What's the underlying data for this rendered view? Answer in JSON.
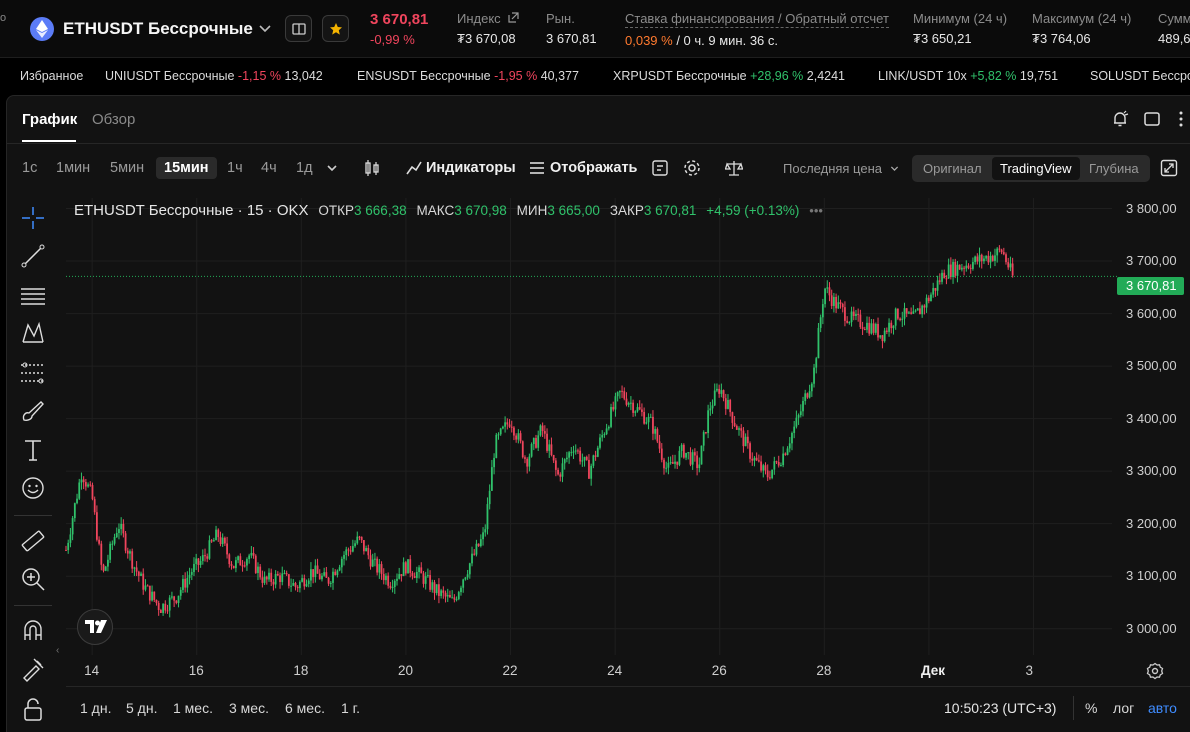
{
  "header": {
    "edge_text": "о",
    "pair": "ETHUSDT Бессрочные",
    "last_price": "3 670,81",
    "last_change": "-0,99 %",
    "stats": [
      {
        "label": "Индекс",
        "value": "₮3 670,08"
      },
      {
        "label": "Рын.",
        "value": "3 670,81"
      },
      {
        "label": "Ставка финансирования / Обратный отсчет",
        "rate": "0,039 %",
        "countdown": " / 0 ч. 9 мин. 36 с."
      },
      {
        "label": "Минимум (24 ч)",
        "value": "₮3 650,21"
      },
      {
        "label": "Максимум (24 ч)",
        "value": "₮3 764,06"
      },
      {
        "label": "Сумм",
        "value": "489,6"
      }
    ]
  },
  "ticker": {
    "favorites_label": "Избранное",
    "items": [
      {
        "name": "UNIUSDT Бессрочные",
        "change": "-1,15 %",
        "price": "13,042",
        "dir": "neg"
      },
      {
        "name": "ENSUSDT Бессрочные",
        "change": "-1,95 %",
        "price": "40,377",
        "dir": "neg"
      },
      {
        "name": "XRPUSDT Бессрочные",
        "change": "+28,96 %",
        "price": "2,4241",
        "dir": "pos"
      },
      {
        "name": "LINK/USDT 10x",
        "change": "+5,82 %",
        "price": "19,751",
        "dir": "pos"
      },
      {
        "name": "SOLUSDT Бессроч",
        "change": "",
        "price": "",
        "dir": "neg"
      }
    ]
  },
  "tabs": {
    "chart": "График",
    "overview": "Обзор"
  },
  "toolbar": {
    "intervals": [
      "1с",
      "1мин",
      "5мин",
      "15мин",
      "1ч",
      "4ч",
      "1д"
    ],
    "active_interval": "15мин",
    "indicators": "Индикаторы",
    "display": "Отображать",
    "price_type": "Последняя цена",
    "views": [
      "Оригинал",
      "TradingView",
      "Глубина"
    ],
    "active_view": "TradingView"
  },
  "legend": {
    "title": "ETHUSDT Бессрочные · 15 · OKX",
    "open_label": "ОТКР",
    "open": "3 666,38",
    "high_label": "МАКС",
    "high": "3 670,98",
    "low_label": "МИН",
    "low": "3 665,00",
    "close_label": "ЗАКР",
    "close": "3 670,81",
    "change": "+4,59 (+0.13%)"
  },
  "bottom": {
    "ranges": [
      "1 дн.",
      "5 дн.",
      "1 мес.",
      "3 мес.",
      "6 мес.",
      "1 г."
    ],
    "clock": "10:50:23 (UTC+3)",
    "percent": "%",
    "log": "лог",
    "auto": "авто"
  },
  "colors": {
    "up": "#30c26b",
    "down": "#f0455d",
    "accent": "#3f8cff",
    "price_tag": "#22ab57"
  },
  "chart_data": {
    "type": "line",
    "ylim": [
      2950,
      3820
    ],
    "yticks": [
      "3 800,00",
      "3 700,00",
      "3 600,00",
      "3 500,00",
      "3 400,00",
      "3 300,00",
      "3 200,00",
      "3 100,00",
      "3 000,00"
    ],
    "ytick_values": [
      3800,
      3700,
      3600,
      3500,
      3400,
      3300,
      3200,
      3100,
      3000
    ],
    "xticks": [
      "14",
      "16",
      "18",
      "20",
      "22",
      "24",
      "26",
      "28",
      "Дек",
      "3"
    ],
    "xtick_positions": [
      14,
      16,
      18,
      20,
      22,
      24,
      26,
      28,
      30,
      32
    ],
    "xlim": [
      13.5,
      33.5
    ],
    "current_price": 3670.81,
    "current_price_label": "3 670,81",
    "series": [
      {
        "x": [
          13.5,
          13.8,
          14.0,
          14.2,
          14.5,
          14.8,
          15.0,
          15.3,
          15.6,
          15.9,
          16.1,
          16.4,
          16.7,
          17.0,
          17.3,
          17.6,
          17.9,
          18.2,
          18.5,
          18.8,
          19.1,
          19.4,
          19.7,
          20.0,
          20.3,
          20.6,
          20.9,
          21.1,
          21.3,
          21.5,
          21.7,
          22.0,
          22.3,
          22.6,
          22.9,
          23.2,
          23.5,
          23.8,
          24.1,
          24.4,
          24.7,
          25.0,
          25.3,
          25.6,
          25.8,
          26.0,
          26.3,
          26.6,
          26.9,
          27.2,
          27.5,
          27.8,
          28.0,
          28.2,
          28.5,
          28.8,
          29.1,
          29.4,
          29.7,
          30.0,
          30.3,
          30.6,
          30.9,
          31.2,
          31.4,
          31.6
        ],
        "y": [
          3150,
          3300,
          3250,
          3100,
          3200,
          3120,
          3080,
          3040,
          3060,
          3110,
          3130,
          3180,
          3120,
          3140,
          3090,
          3100,
          3080,
          3110,
          3090,
          3140,
          3170,
          3120,
          3090,
          3120,
          3100,
          3070,
          3050,
          3100,
          3140,
          3180,
          3350,
          3400,
          3320,
          3380,
          3290,
          3350,
          3300,
          3380,
          3450,
          3420,
          3390,
          3300,
          3340,
          3310,
          3420,
          3460,
          3390,
          3330,
          3290,
          3330,
          3400,
          3490,
          3650,
          3620,
          3590,
          3580,
          3560,
          3600,
          3590,
          3630,
          3680,
          3690,
          3700,
          3710,
          3720,
          3670
        ]
      }
    ]
  }
}
